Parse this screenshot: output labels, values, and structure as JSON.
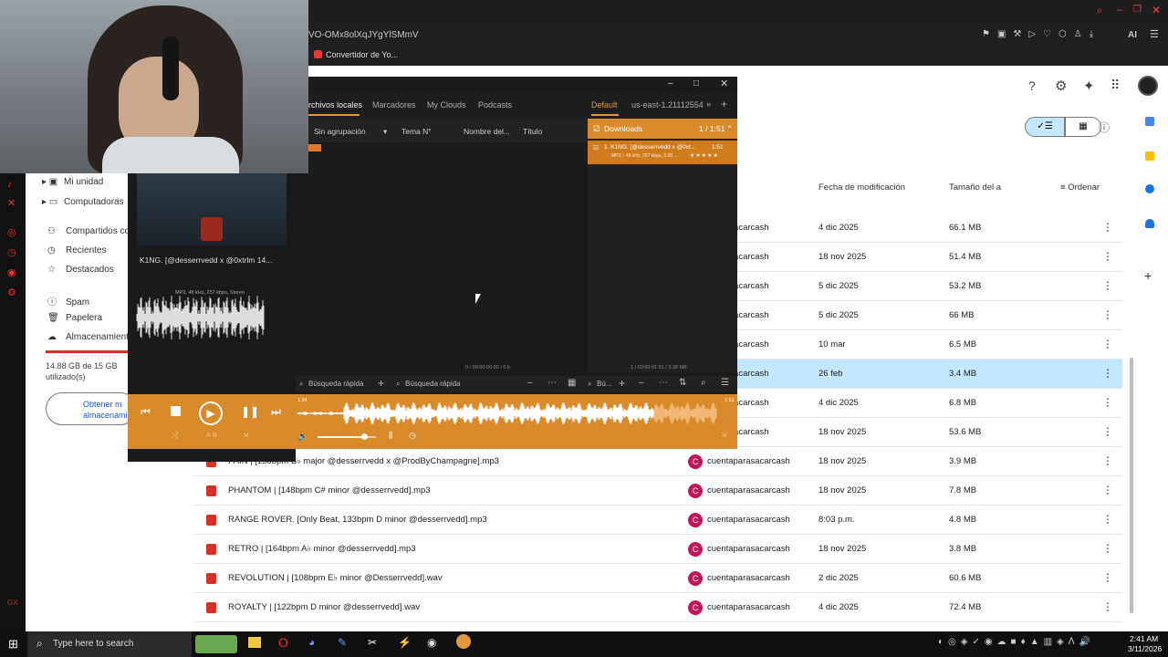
{
  "browser": {
    "url_fragment": "VO-OMx8olXqJYgYlSMmV",
    "bookmark": "Convertidor de Yo...",
    "ext_label": "AI"
  },
  "drive": {
    "nav": [
      {
        "label": "Mi unidad"
      },
      {
        "label": "Computadoras"
      },
      {
        "label": "Compartidos co"
      },
      {
        "label": "Recientes"
      },
      {
        "label": "Destacados"
      },
      {
        "label": "Spam"
      },
      {
        "label": "Papelera"
      },
      {
        "label": "Almacenamient"
      }
    ],
    "storage_text": "14.88 GB de 15 GB utilizado(s)",
    "get_more_button": "Obtener m almacenami",
    "columns": {
      "modified": "Fecha de modificación",
      "size": "Tamaño del a",
      "sort": "Ordenar"
    },
    "rows": [
      {
        "name": "",
        "owner": "aparasacarcash",
        "date": "4 dic 2025",
        "size": "66.1 MB"
      },
      {
        "name": "",
        "owner": "aparasacarcash",
        "date": "18 nov 2025",
        "size": "51.4 MB"
      },
      {
        "name": "",
        "owner": "aparasacarcash",
        "date": "5 dic 2025",
        "size": "53.2 MB"
      },
      {
        "name": "",
        "owner": "aparasacarcash",
        "date": "5 dic 2025",
        "size": "66 MB"
      },
      {
        "name": "",
        "owner": "aparasacarcash",
        "date": "10 mar",
        "size": "6.5 MB"
      },
      {
        "name": "",
        "owner": "aparasacarcash",
        "date": "26 feb",
        "size": "3.4 MB"
      },
      {
        "name": "",
        "owner": "aparasacarcash",
        "date": "4 dic 2025",
        "size": "6.8 MB"
      },
      {
        "name": "",
        "owner": "aparasacarcash",
        "date": "18 nov 2025",
        "size": "53.6 MB"
      },
      {
        "name": "PAIN | [158bpm B♭ major @desserrvedd x @ProdByChampagne].mp3",
        "owner": "cuentaparasacarcash",
        "date": "18 nov 2025",
        "size": "3.9 MB"
      },
      {
        "name": "PHANTOM | [148bpm C# minor @desserrvedd].mp3",
        "owner": "cuentaparasacarcash",
        "date": "18 nov 2025",
        "size": "7.8 MB"
      },
      {
        "name": "RANGE ROVER. [Only Beat, 133bpm D minor @desserrvedd].mp3",
        "owner": "cuentaparasacarcash",
        "date": "8:03 p.m.",
        "size": "4.8 MB"
      },
      {
        "name": "RETRO | [164bpm A♭ minor @desserrvedd].mp3",
        "owner": "cuentaparasacarcash",
        "date": "18 nov 2025",
        "size": "3.8 MB"
      },
      {
        "name": "REVOLUTION | [108bpm E♭ minor @Desserrvedd].wav",
        "owner": "cuentaparasacarcash",
        "date": "2 dic 2025",
        "size": "60.6 MB"
      },
      {
        "name": "ROYALTY | [122bpm D minor @desserrvedd].wav",
        "owner": "cuentaparasacarcash",
        "date": "4 dic 2025",
        "size": "72.4 MB"
      }
    ],
    "owner_initial": "C"
  },
  "player": {
    "tabs": [
      "rchivos locales",
      "Marcadores",
      "My Clouds",
      "Podcasts"
    ],
    "right_tabs": [
      "Default",
      "us-east-1.21112554"
    ],
    "list_headers": [
      "Sin agrupación",
      "Tema N°",
      "Nombre del...",
      "Título"
    ],
    "playlist_title": "Downloads",
    "playlist_count": "1 / 1:51",
    "track_title": "1. K1NG.  [@desserrvedd x @0xt...",
    "track_time": "1:51",
    "track_meta": "MP3 :: 48 kHz, 257 kbps, 3.38 ...",
    "now_playing": "K1NG.  [@desserrvedd x @0xtrlm 14...",
    "format_info": "MP3, 48 kHz, 257 kbps, Stereo",
    "status_left": "0 / 00:00:00:00 / 0 b",
    "status_right": "1 / 00:00:01:51 / 3.38 MB",
    "search1": "Búsqueda rápida",
    "search2": "Búsqueda rápida",
    "search3": "Bú...",
    "pos_start": "1:34",
    "pos_end": "1:51",
    "ab_label": "A-B",
    "progress": 0.85,
    "volume": 0.8
  },
  "taskbar": {
    "search_placeholder": "Type here to search",
    "time": "2:41 AM",
    "date": "3/11/2026"
  }
}
